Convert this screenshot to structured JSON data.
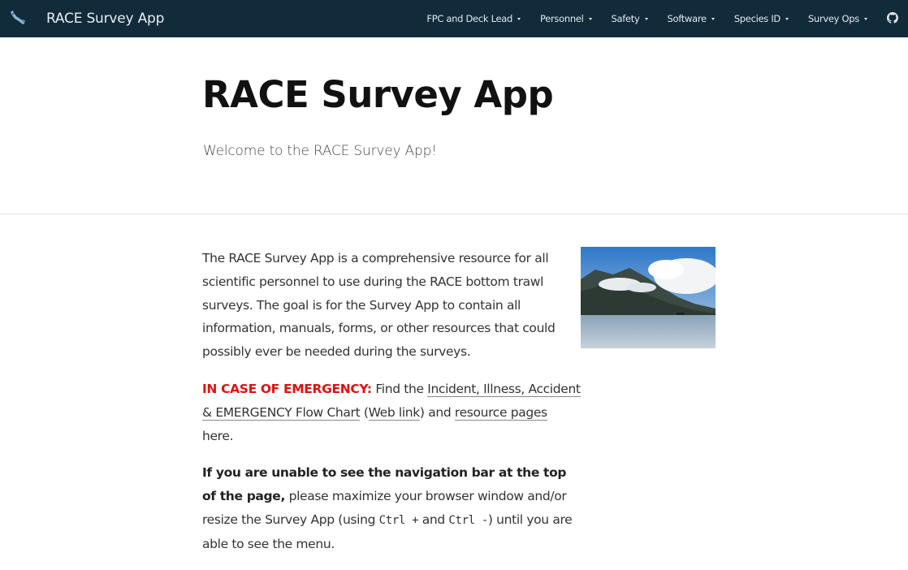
{
  "navbar": {
    "brand_title": "RACE Survey App",
    "brand_icon": "fish-icon",
    "menus": [
      {
        "label": "FPC and Deck Lead"
      },
      {
        "label": "Personnel"
      },
      {
        "label": "Safety"
      },
      {
        "label": "Software"
      },
      {
        "label": "Species ID"
      },
      {
        "label": "Survey Ops"
      }
    ],
    "github_icon": "github-icon"
  },
  "hero": {
    "title": "RACE Survey App",
    "subtitle": "Welcome to the RACE Survey App!"
  },
  "content": {
    "intro": "The RACE Survey App is a comprehensive resource for all scientific personnel to use during the RACE bottom trawl surveys. The goal is for the Survey App to contain all information, manuals, forms, or other resources that could possibly ever be needed during the surveys.",
    "emergency": {
      "label": "IN CASE OF EMERGENCY:",
      "text_1": " Find the ",
      "link_flowchart": "Incident, Illness, Accident & EMERGENCY Flow Chart",
      "text_2": " (",
      "link_web": "Web link",
      "text_3": ") and ",
      "link_resources": "resource pages",
      "text_4": " here."
    },
    "navbar_note": {
      "bold": "If you are unable to see the navigation bar at the top of the page,",
      "text_1": " please maximize your browser window and/or resize the Survey App (using ",
      "key_1": "Ctrl +",
      "text_2": " and ",
      "key_2": "Ctrl -",
      "text_3": ") until you are able to see the menu."
    }
  },
  "colors": {
    "navbar_bg": "#112b3b",
    "emergency_red": "#e0110f"
  }
}
